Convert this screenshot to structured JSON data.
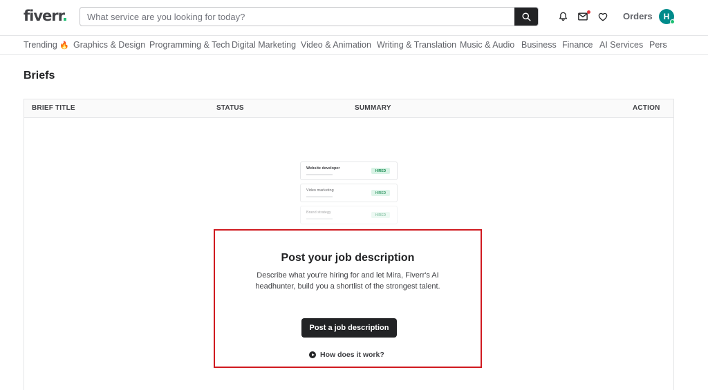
{
  "header": {
    "logo_text": "fiverr",
    "logo_dot": ".",
    "search_placeholder": "What service are you looking for today?",
    "orders_label": "Orders",
    "avatar_initial": "H"
  },
  "categories": [
    "Trending",
    "Graphics & Design",
    "Programming & Tech",
    "Digital Marketing",
    "Video & Animation",
    "Writing & Translation",
    "Music & Audio",
    "Business",
    "Finance",
    "AI Services",
    "Pers"
  ],
  "page": {
    "title": "Briefs"
  },
  "table": {
    "columns": [
      "BRIEF TITLE",
      "STATUS",
      "SUMMARY",
      "ACTION"
    ]
  },
  "illustration": {
    "cards": [
      {
        "title": "Website developer",
        "badge": "HIRED"
      },
      {
        "title": "Video marketing",
        "badge": "HIRED"
      },
      {
        "title": "Brand strategy",
        "badge": "HIRED"
      }
    ]
  },
  "cta": {
    "title": "Post your job description",
    "description": "Describe what you're hiring for and let Mira, Fiverr's AI headhunter, build you a shortlist of the strongest talent.",
    "button_label": "Post a job description",
    "how_label": "How does it work?"
  },
  "colors": {
    "brand_green": "#1dbf73",
    "dark": "#222325",
    "highlight_border": "#d0191f"
  }
}
